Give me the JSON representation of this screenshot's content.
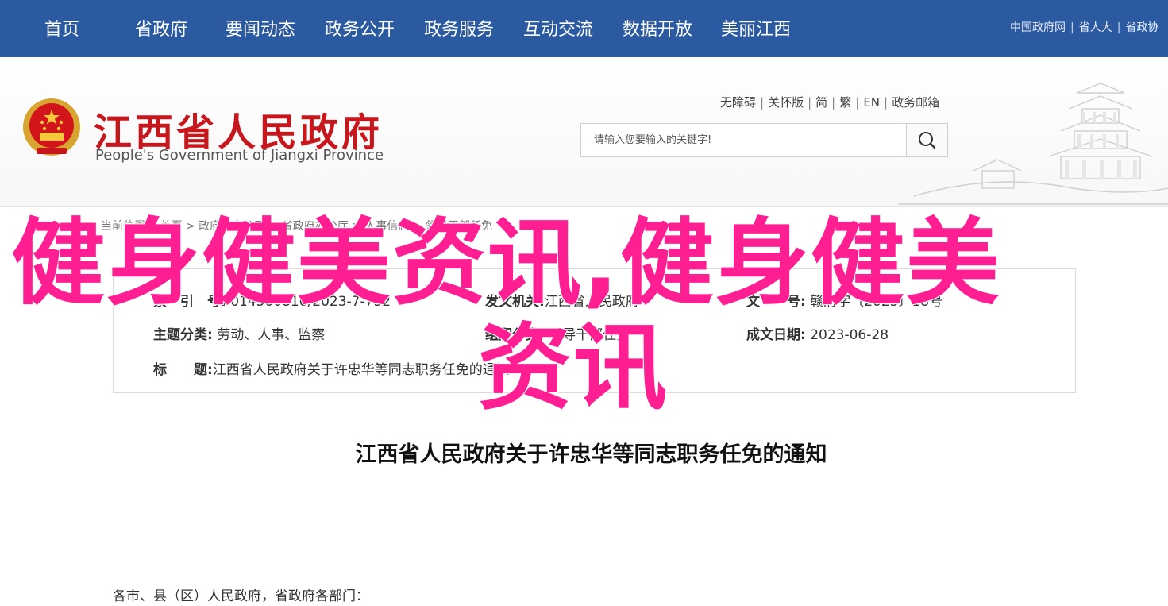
{
  "nav": {
    "items": [
      "首页",
      "省政府",
      "要闻动态",
      "政务公开",
      "政务服务",
      "互动交流",
      "数据开放",
      "美丽江西"
    ],
    "right_links": [
      "中国政府网",
      "省人大",
      "省政协"
    ]
  },
  "header": {
    "title": "江西省人民政府",
    "subtitle": "People's Government of Jiangxi Province",
    "mini_links": [
      "无障碍",
      "关怀版",
      "简",
      "繁",
      "EN",
      "政务邮箱"
    ],
    "search_placeholder": "请输入您要输入的关键字!"
  },
  "breadcrumb": {
    "text": "当前位置：  首页  >  政府信息公开  >  省政府办公厅  >  人事信息  >  领导干部任免"
  },
  "info": {
    "index_label": "索　引　号:",
    "index_value": "014500810/2023-7-732",
    "issuer_label": "发文机关:",
    "issuer_value": "江西省人民政府",
    "docno_label": "文　　号:",
    "docno_value": "赣府字〔2023〕18号",
    "topic_label": "主题分类:",
    "topic_value": "劳动、人事、监察",
    "genre_label": "组配分类:",
    "genre_value": "领导干部任免",
    "date_label": "成文日期:",
    "date_value": "2023-06-28",
    "title_label": "标　　题:",
    "title_value": "江西省人民政府关于许忠华等同志职务任免的通知"
  },
  "document": {
    "title": "江西省人民政府关于许忠华等同志职务任免的通知",
    "salutation": "各市、县（区）人民政府，省政府各部门："
  },
  "overlay": {
    "line1": "健身健美资讯,健身健美",
    "line2": "资讯",
    "color": "#ff1f93"
  },
  "colors": {
    "nav_bg": "#2c5aa0",
    "brand_red": "#c8161d"
  }
}
